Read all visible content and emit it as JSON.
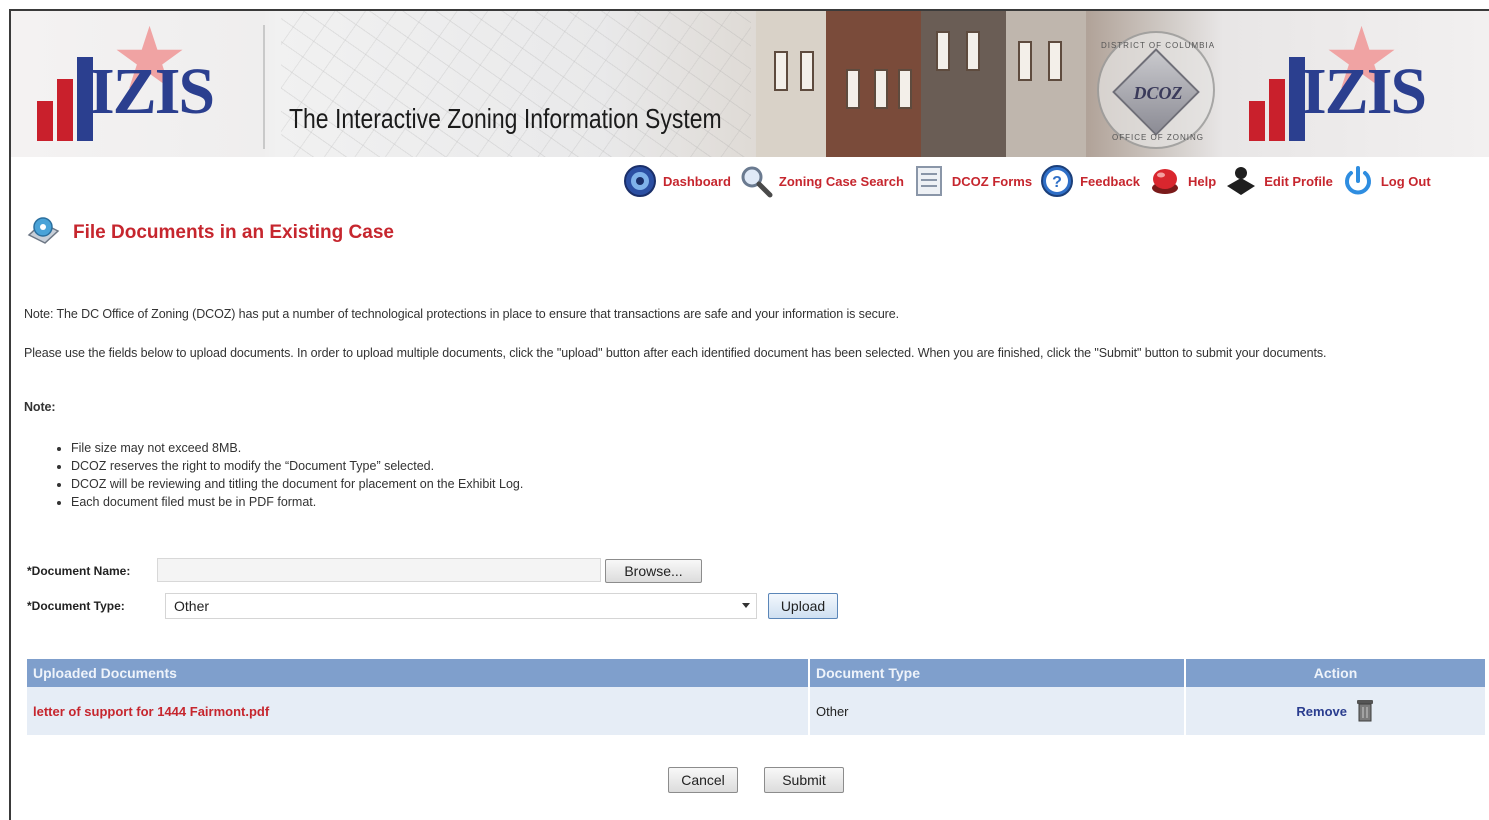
{
  "header": {
    "logo_text": "IZIS",
    "tagline": "The Interactive Zoning Information System",
    "seal_text": "DCOZ",
    "seal_arc_top": "DISTRICT OF COLUMBIA",
    "seal_arc_bottom": "OFFICE OF ZONING"
  },
  "nav": {
    "items": [
      {
        "label": "Dashboard",
        "icon": "dashboard-icon"
      },
      {
        "label": "Zoning Case Search",
        "icon": "magnifier-icon"
      },
      {
        "label": "DCOZ Forms",
        "icon": "forms-icon"
      },
      {
        "label": "Feedback",
        "icon": "question-icon"
      },
      {
        "label": "Help",
        "icon": "help-button-icon"
      },
      {
        "label": "Edit Profile",
        "icon": "user-icon"
      },
      {
        "label": "Log Out",
        "icon": "power-icon"
      }
    ]
  },
  "page": {
    "title": "File Documents in an Existing Case",
    "note_security": "Note: The DC Office of Zoning (DCOZ) has put a number of technological protections in place to ensure that transactions are safe and your information is secure.",
    "instructions": "Please use the fields below to upload documents. In order to upload multiple documents, click the \"upload\" button after each identified document has been selected. When you are finished, click the \"Submit\" button to submit your documents.",
    "note_heading": "Note:",
    "bullets": [
      "File size may not exceed 8MB.",
      "DCOZ reserves the right to modify the “Document Type” selected.",
      "DCOZ will be reviewing and titling the document for placement on the Exhibit Log.",
      "Each document filed must be in PDF format."
    ]
  },
  "form": {
    "doc_name_label": "*Document Name:",
    "doc_name_value": "",
    "browse_label": "Browse...",
    "doc_type_label": "*Document Type:",
    "doc_type_value": "Other",
    "upload_label": "Upload"
  },
  "table": {
    "headers": [
      "Uploaded Documents",
      "Document Type",
      "Action"
    ],
    "rows": [
      {
        "name": "letter of support for 1444 Fairmont.pdf",
        "type": "Other",
        "action": "Remove"
      }
    ]
  },
  "footer": {
    "cancel_label": "Cancel",
    "submit_label": "Submit"
  },
  "colors": {
    "accent_red": "#c6262e",
    "table_header": "#7f9fcc",
    "table_row": "#e6edf6",
    "link_blue": "#2a3d8f"
  }
}
